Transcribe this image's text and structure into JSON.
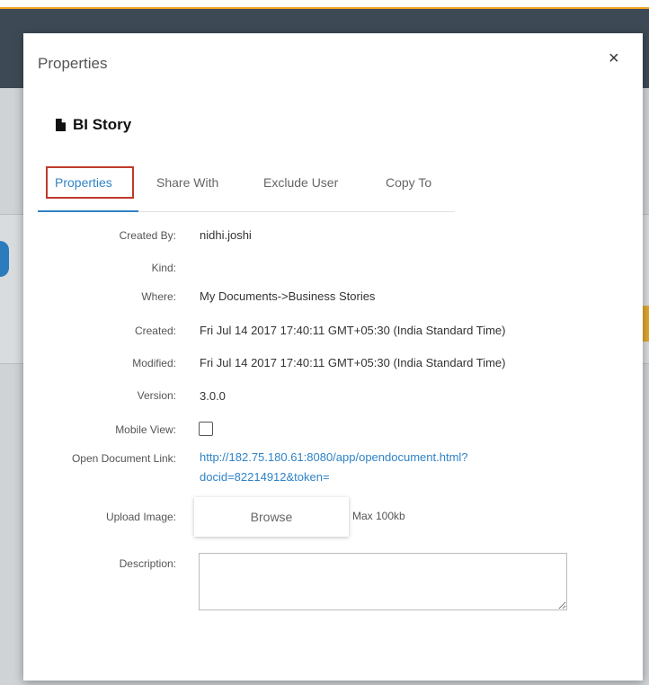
{
  "modal": {
    "title": "Properties",
    "close_label": "×",
    "doc_name": "BI Story"
  },
  "tabs": [
    {
      "label": "Properties",
      "active": true
    },
    {
      "label": "Share With",
      "active": false
    },
    {
      "label": "Exclude User",
      "active": false
    },
    {
      "label": "Copy To",
      "active": false
    }
  ],
  "fields": {
    "created_by": {
      "label": "Created By:",
      "value": "nidhi.joshi"
    },
    "kind": {
      "label": "Kind:",
      "value": ""
    },
    "where": {
      "label": "Where:",
      "value": "My Documents->Business Stories"
    },
    "created": {
      "label": "Created:",
      "value": "Fri Jul 14 2017 17:40:11 GMT+05:30 (India Standard Time)"
    },
    "modified": {
      "label": "Modified:",
      "value": "Fri Jul 14 2017 17:40:11 GMT+05:30 (India Standard Time)"
    },
    "version": {
      "label": "Version:",
      "value": "3.0.0"
    },
    "mobile_view": {
      "label": "Mobile View:",
      "checked": false
    },
    "open_document_link": {
      "label": "Open Document Link:",
      "line1": "http://182.75.180.61:8080/app/opendocument.html?",
      "line2": "docid=82214912&token="
    },
    "upload_image": {
      "label": "Upload Image:",
      "button": "Browse",
      "note": "Max 100kb"
    },
    "description": {
      "label": "Description:",
      "value": ""
    }
  },
  "colors": {
    "accent": "#2f83c7",
    "highlight_box": "#c0392b"
  }
}
